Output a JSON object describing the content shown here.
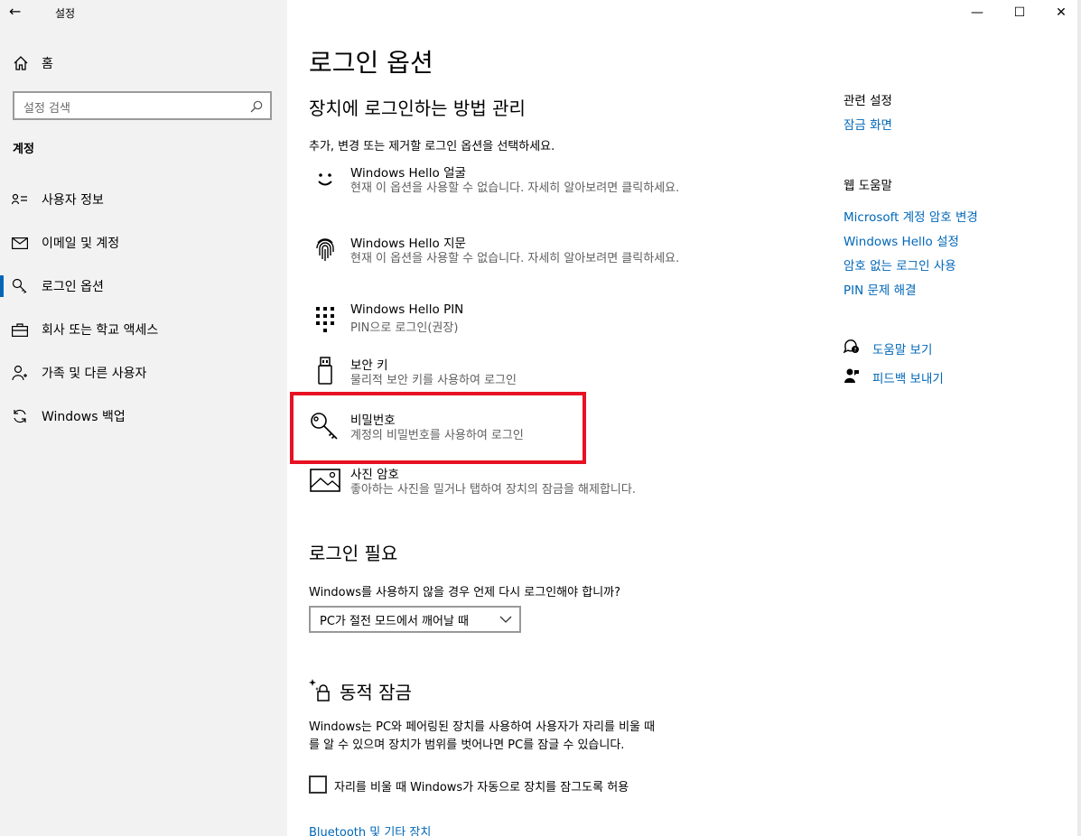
{
  "window": {
    "app_title": "설정",
    "back_glyph": "←",
    "minimize_glyph": "—",
    "maximize_glyph": "☐",
    "close_glyph": "✕"
  },
  "sidebar": {
    "home_label": "홈",
    "search_placeholder": "설정 검색",
    "section_title": "계정",
    "items": [
      {
        "label": "사용자 정보",
        "icon": "user-card-icon"
      },
      {
        "label": "이메일 및 계정",
        "icon": "mail-icon"
      },
      {
        "label": "로그인 옵션",
        "icon": "key-icon",
        "active": true
      },
      {
        "label": "회사 또는 학교 액세스",
        "icon": "briefcase-icon"
      },
      {
        "label": "가족 및 다른 사용자",
        "icon": "people-icon"
      },
      {
        "label": "Windows 백업",
        "icon": "sync-icon"
      }
    ]
  },
  "main": {
    "title": "로그인 옵션",
    "manage_heading": "장치에 로그인하는 방법 관리",
    "manage_desc": "추가, 변경 또는 제거할 로그인 옵션을 선택하세요.",
    "options": [
      {
        "title": "Windows Hello 얼굴",
        "desc": "현재 이 옵션을 사용할 수 없습니다. 자세히 알아보려면 클릭하세요.",
        "icon": "face-icon"
      },
      {
        "title": "Windows Hello 지문",
        "desc": "현재 이 옵션을 사용할 수 없습니다. 자세히 알아보려면 클릭하세요.",
        "icon": "fingerprint-icon"
      },
      {
        "title": "Windows Hello PIN",
        "desc": "PIN으로 로그인(권장)",
        "icon": "pin-keypad-icon"
      },
      {
        "title": "보안 키",
        "desc": "물리적 보안 키를 사용하여 로그인",
        "icon": "usb-key-icon"
      },
      {
        "title": "비밀번호",
        "desc": "계정의 비밀번호를 사용하여 로그인",
        "icon": "password-key-icon"
      },
      {
        "title": "사진 암호",
        "desc": "좋아하는 사진을 밀거나 탭하여 장치의 잠금을 해제합니다.",
        "icon": "picture-icon"
      }
    ],
    "require_heading": "로그인 필요",
    "require_question": "Windows를 사용하지 않을 경우 언제 다시 로그인해야 합니까?",
    "require_selected": "PC가 절전 모드에서 깨어날 때",
    "dynamic_heading": "동적 잠금",
    "dynamic_desc_line1": "Windows는 PC와 페어링된 장치를 사용하여 사용자가 자리를 비울 때",
    "dynamic_desc_line2": "를 알 수 있으며 장치가 범위를 벗어나면 PC를 잠글 수 있습니다.",
    "dynamic_checkbox_label": "자리를 비울 때 Windows가 자동으로 장치를 잠그도록 허용",
    "bluetooth_link": "Bluetooth 및 기타 장치"
  },
  "right_pane": {
    "related_heading": "관련 설정",
    "related_links": [
      "잠금 화면"
    ],
    "help_heading": "웹 도움말",
    "help_links": [
      "Microsoft 계정 암호 변경",
      "Windows Hello 설정",
      "암호 없는 로그인 사용",
      "PIN 문제 해결"
    ],
    "get_help": "도움말 보기",
    "feedback": "피드백 보내기"
  },
  "colors": {
    "accent": "#0067b8",
    "highlight": "#e81123",
    "sidebar_bg": "#f2f2f2"
  }
}
